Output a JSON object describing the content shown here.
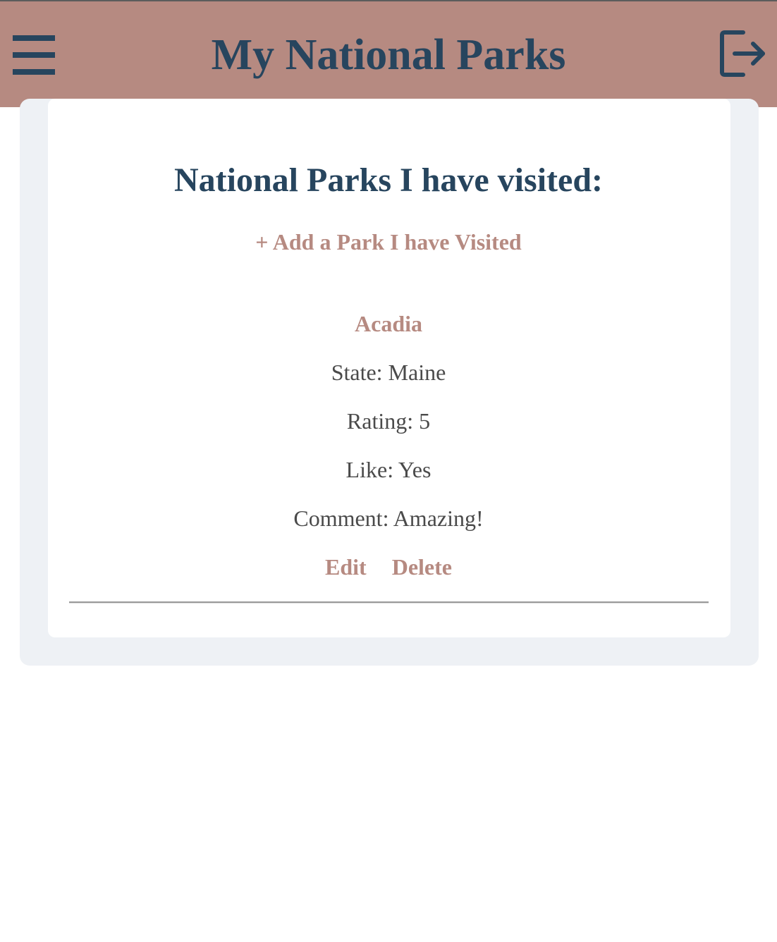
{
  "header": {
    "title": "My National Parks",
    "menu_icon": "hamburger-menu-icon",
    "logout_icon": "logout-icon"
  },
  "main": {
    "heading": "National Parks I have visited:",
    "add_link": "+ Add a Park I have Visited",
    "parks": [
      {
        "name": "Acadia",
        "state": "State: Maine",
        "rating": "Rating: 5",
        "like": "Like: Yes",
        "comment": "Comment: Amazing!",
        "edit_label": "Edit",
        "delete_label": "Delete"
      }
    ]
  },
  "colors": {
    "header_bg": "#b68a81",
    "primary_text": "#27455e",
    "accent": "#b68a81",
    "body_text": "#4a4a4a",
    "panel_bg": "#eef1f5"
  }
}
